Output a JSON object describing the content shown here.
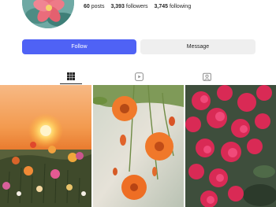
{
  "profile": {
    "avatar_icon": "flower-avatar-icon",
    "stats": {
      "posts_value": "60",
      "posts_label": "posts",
      "followers_value": "3,393",
      "followers_label": "followers",
      "following_value": "3,745",
      "following_label": "following"
    }
  },
  "actions": {
    "follow_label": "Follow",
    "message_label": "Message",
    "follow_color": "#4f62f5",
    "message_color": "#efefef"
  },
  "tabs": [
    {
      "name": "posts",
      "icon": "grid-icon",
      "active": true
    },
    {
      "name": "reels",
      "icon": "reels-icon",
      "active": false
    },
    {
      "name": "tagged",
      "icon": "tagged-icon",
      "active": false
    }
  ],
  "posts": [
    {
      "icon": "sunset-meadow-photo"
    },
    {
      "icon": "orange-flowers-photo"
    },
    {
      "icon": "pink-bougainvillea-photo"
    }
  ]
}
